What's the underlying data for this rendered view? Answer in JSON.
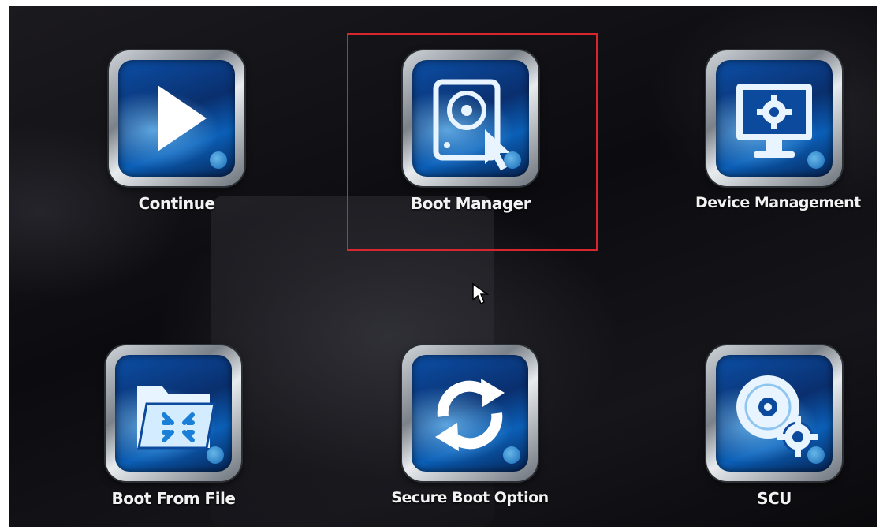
{
  "tiles": [
    {
      "id": "continue",
      "label": "Continue",
      "icon": "play-icon"
    },
    {
      "id": "boot-manager",
      "label": "Boot Manager",
      "icon": "hard-drive-pointer-icon",
      "selected": true
    },
    {
      "id": "device-management",
      "label": "Device Management",
      "icon": "monitor-gear-icon"
    },
    {
      "id": "boot-from-file",
      "label": "Boot From File",
      "icon": "folder-icon"
    },
    {
      "id": "secure-boot-option",
      "label": "Secure Boot Option",
      "icon": "refresh-icon"
    },
    {
      "id": "scu",
      "label": "SCU",
      "icon": "disc-gear-icon"
    }
  ],
  "colors": {
    "selection": "#d8262e",
    "tile_blue": "#0c4fa6",
    "label": "#f2f2f2"
  }
}
